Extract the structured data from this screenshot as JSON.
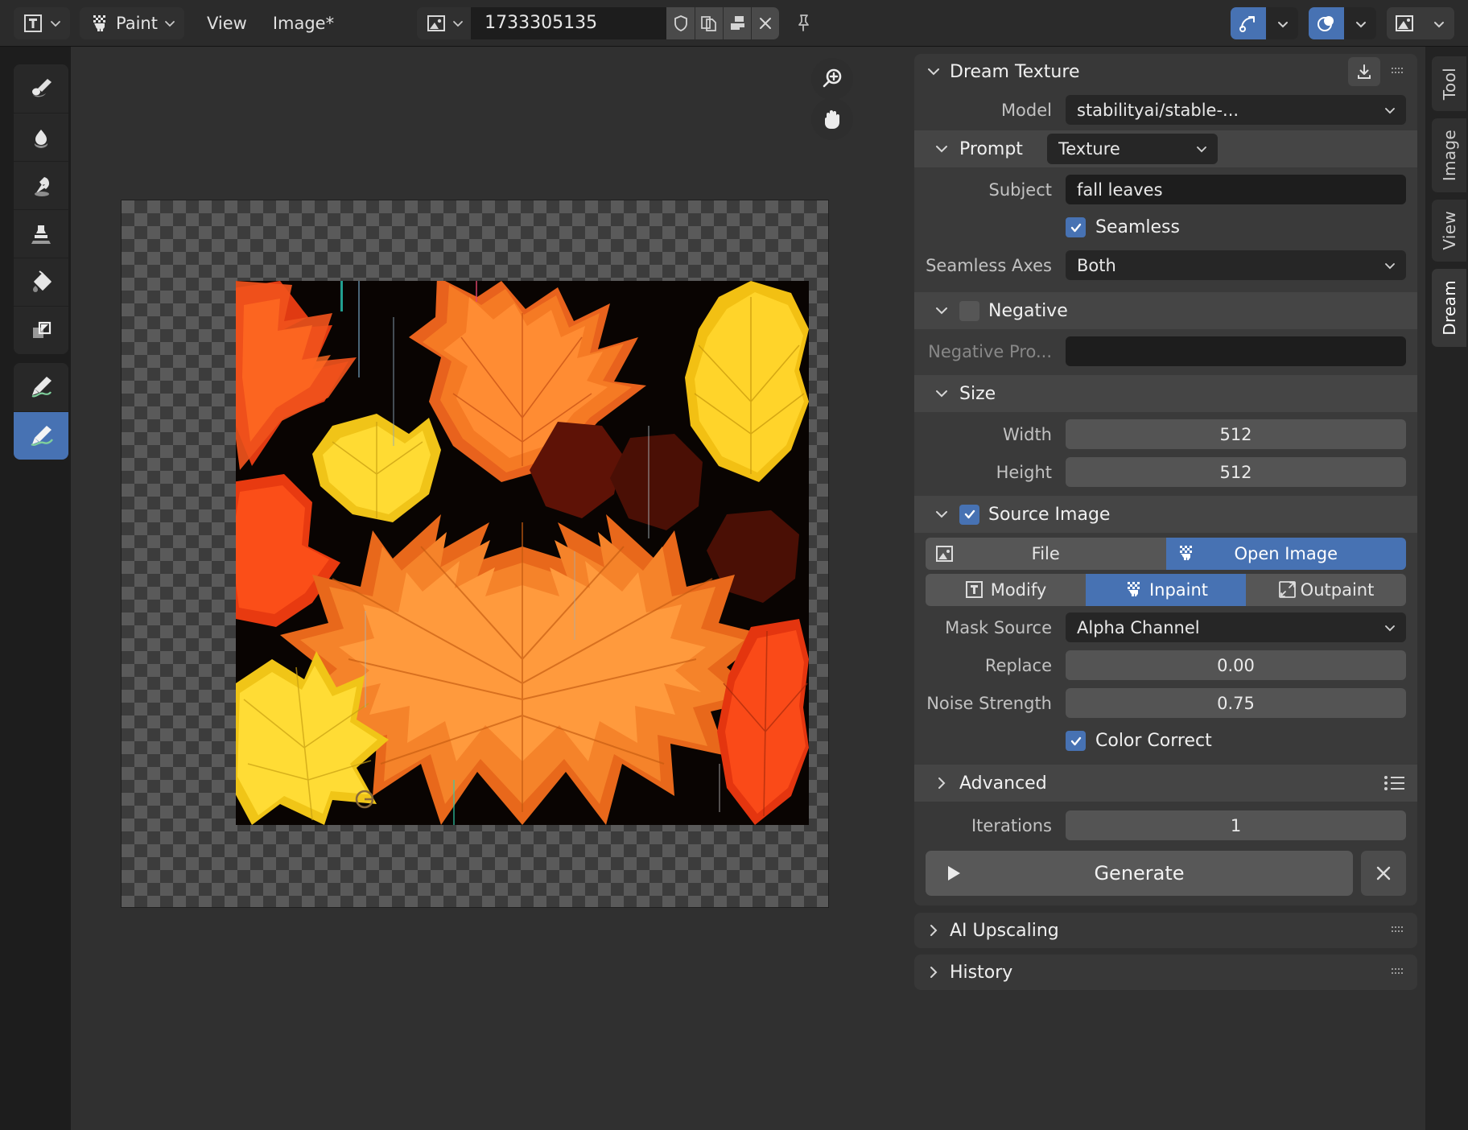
{
  "header": {
    "editor_type_icon": "image-editor-icon",
    "mode_button": {
      "label": "Paint",
      "icon": "paint-mode-icon"
    },
    "menus": [
      "View",
      "Image*"
    ],
    "image_datablock": {
      "browse_icon": "browse-image-icon",
      "name": "1733305135",
      "fake_user_icon": "shield-icon",
      "new_icon": "duplicate-icon",
      "copy_icon": "copy-to-new-icon",
      "unlink_icon": "close-icon",
      "pin_icon": "pin-icon"
    },
    "right_toggles": [
      {
        "icon": "snap-icon",
        "active": true
      },
      {
        "icon": "overlays-icon",
        "active": true
      },
      {
        "icon": "view-display-icon",
        "active": false
      }
    ]
  },
  "toolbar": {
    "groups": [
      [
        {
          "name": "draw-tool",
          "icon": "brush-icon",
          "active": false
        },
        {
          "name": "soften-tool",
          "icon": "droplet-icon",
          "active": false
        },
        {
          "name": "smear-tool",
          "icon": "smear-icon",
          "active": false
        },
        {
          "name": "clone-tool",
          "icon": "stamp-icon",
          "active": false
        },
        {
          "name": "fill-tool",
          "icon": "paint-bucket-icon",
          "active": false
        },
        {
          "name": "mask-tool",
          "icon": "mask-icon",
          "active": false
        }
      ],
      [
        {
          "name": "annotate-tool",
          "icon": "pencil-icon",
          "active": false
        },
        {
          "name": "annotate-line-tool",
          "icon": "brush-stroke-icon",
          "active": true
        }
      ]
    ]
  },
  "canvas": {
    "nav_buttons": [
      {
        "name": "zoom-button",
        "icon": "magnifier-plus-icon"
      },
      {
        "name": "pan-button",
        "icon": "hand-icon"
      }
    ]
  },
  "dream_texture": {
    "title": "Dream Texture",
    "download_icon": "download-icon",
    "grip_icon": "grip-icon",
    "model_label": "Model",
    "model_value": "stabilityai/stable-...",
    "prompt": {
      "title": "Prompt",
      "structure_value": "Texture",
      "subject_label": "Subject",
      "subject_value": "fall leaves",
      "seamless_label": "Seamless",
      "seamless_checked": true,
      "seamless_axes_label": "Seamless Axes",
      "seamless_axes_value": "Both"
    },
    "negative": {
      "title": "Negative",
      "enabled": false,
      "prompt_label": "Negative Pro...",
      "prompt_value": ""
    },
    "size": {
      "title": "Size",
      "width_label": "Width",
      "width_value": "512",
      "height_label": "Height",
      "height_value": "512"
    },
    "source_image": {
      "title": "Source Image",
      "enabled": true,
      "origin": [
        {
          "label": "File",
          "icon": "image-file-icon",
          "selected": false
        },
        {
          "label": "Open Image",
          "icon": "open-image-icon",
          "selected": true
        }
      ],
      "action": [
        {
          "label": "Modify",
          "icon": "modify-icon",
          "selected": false
        },
        {
          "label": "Inpaint",
          "icon": "inpaint-icon",
          "selected": true
        },
        {
          "label": "Outpaint",
          "icon": "outpaint-icon",
          "selected": false
        }
      ],
      "mask_source_label": "Mask Source",
      "mask_source_value": "Alpha Channel",
      "replace_label": "Replace",
      "replace_value": "0.00",
      "noise_strength_label": "Noise Strength",
      "noise_strength_value": "0.75",
      "color_correct_label": "Color Correct",
      "color_correct_checked": true
    },
    "advanced": {
      "title": "Advanced",
      "preset_icon": "preset-list-icon"
    },
    "iterations_label": "Iterations",
    "iterations_value": "1",
    "generate_label": "Generate",
    "generate_icon": "play-icon",
    "cancel_icon": "close-icon"
  },
  "bottom_panels": [
    {
      "title": "AI Upscaling",
      "grip_icon": "grip-icon"
    },
    {
      "title": "History",
      "grip_icon": "grip-icon"
    }
  ],
  "vertical_tabs": [
    {
      "label": "Tool",
      "active": false
    },
    {
      "label": "Image",
      "active": false
    },
    {
      "label": "View",
      "active": false
    },
    {
      "label": "Dream",
      "active": true
    }
  ],
  "colors": {
    "accent_blue": "#4772b3",
    "panel_bg": "#303030",
    "box_bg": "#383838",
    "field_bg": "#1d1d1d"
  }
}
